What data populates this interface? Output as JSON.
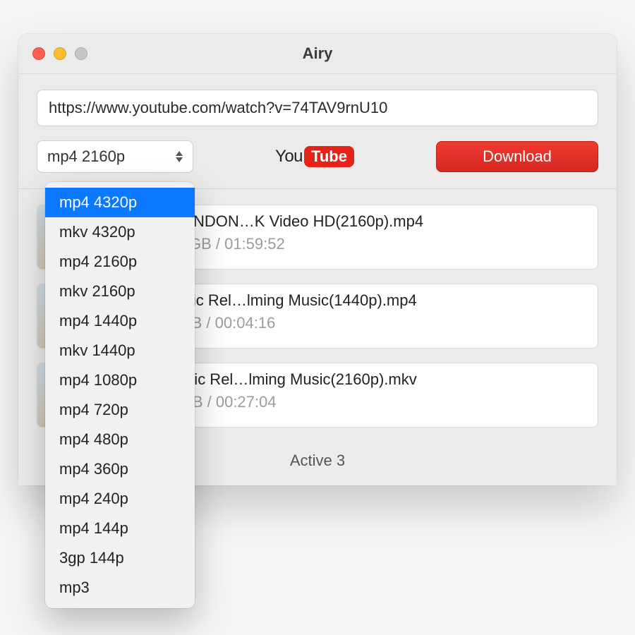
{
  "window": {
    "title": "Airy"
  },
  "url": {
    "value": "https://www.youtube.com/watch?v=74TAV9rnU10"
  },
  "format": {
    "selected": "mp4 2160p",
    "options": [
      "mp4 4320p",
      "mkv 4320p",
      "mp4 2160p",
      "mkv 2160p",
      "mp4 1440p",
      "mkv 1440p",
      "mp4 1080p",
      "mp4 720p",
      "mp4 480p",
      "mp4 360p",
      "mp4 240p",
      "mp4 144p",
      "3gp 144p",
      "mp3"
    ],
    "highlighted_index": 0
  },
  "source_logo": {
    "you": "You",
    "tube": "Tube"
  },
  "download_button": "Download",
  "downloads": [
    {
      "title": "ING OVER LONDON…K Video HD(2160p).mp4",
      "status": ") GB of 18.54 GB / 01:59:52",
      "progress_percent": 0
    },
    {
      "title": "way 4K - Scenic Rel…lming Music(1440p).mp4",
      "status": "! GB of 3.27 GB / 00:04:16",
      "progress_percent": 6
    },
    {
      "title": "aine 4K - Scenic Rel…lming Music(2160p).mkv",
      "status": "- GB of 7.36 GB / 00:27:04",
      "progress_percent": 4
    }
  ],
  "footer": {
    "active_label": "Active 3"
  }
}
